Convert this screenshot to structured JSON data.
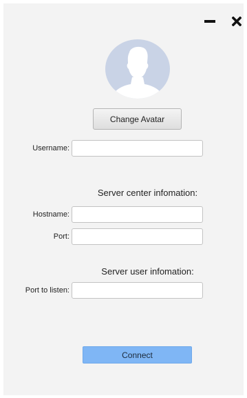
{
  "window_controls": {
    "minimize_icon": "minimize-icon",
    "close_icon": "close-icon"
  },
  "avatar": {
    "icon": "default-user-avatar-icon",
    "colors": {
      "circle": "#c9d3e6",
      "silhouette": "#ffffff"
    }
  },
  "change_avatar_label": "Change Avatar",
  "username": {
    "label": "Username:",
    "value": ""
  },
  "server_center": {
    "heading": "Server center infomation:",
    "hostname": {
      "label": "Hostname:",
      "value": ""
    },
    "port": {
      "label": "Port:",
      "value": ""
    }
  },
  "server_user": {
    "heading": "Server user infomation:",
    "port_to_listen": {
      "label": "Port to listen:",
      "value": ""
    }
  },
  "connect_label": "Connect",
  "colors": {
    "window_bg": "#f3f3f3",
    "connect_bg": "#7fb6f5"
  }
}
